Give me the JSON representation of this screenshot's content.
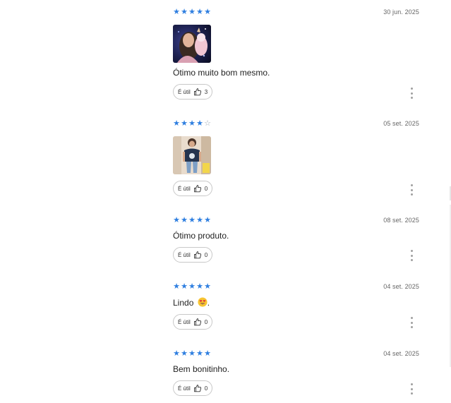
{
  "reviews": [
    {
      "rating": 5,
      "date": "30 jun. 2025",
      "has_photo": true,
      "comment": "Ótimo muito bom mesmo.",
      "helpful_label": "É útil",
      "helpful_count": "3"
    },
    {
      "rating": 4,
      "date": "05 set. 2025",
      "has_photo": true,
      "comment": "",
      "helpful_label": "É útil",
      "helpful_count": "0"
    },
    {
      "rating": 5,
      "date": "08 set. 2025",
      "has_photo": false,
      "comment": "Ótimo produto.",
      "helpful_label": "É útil",
      "helpful_count": "0"
    },
    {
      "rating": 5,
      "date": "04 set. 2025",
      "has_photo": false,
      "comment": "Lindo",
      "comment_suffix": ".",
      "comment_emoji": "heart-eyes-emoji",
      "helpful_label": "É útil",
      "helpful_count": "0"
    },
    {
      "rating": 5,
      "date": "04 set. 2025",
      "has_photo": false,
      "comment": "Bem bonitinho.",
      "helpful_label": "É útil",
      "helpful_count": "0"
    }
  ],
  "colors": {
    "star_filled": "#2f7fe0",
    "star_empty": "#9aa6b2",
    "pill_border": "#c8c8c8",
    "kebab": "#a0a0a0"
  },
  "icons": {
    "star": "star-icon",
    "thumb": "thumbs-up-icon",
    "more": "more-vertical-icon"
  }
}
